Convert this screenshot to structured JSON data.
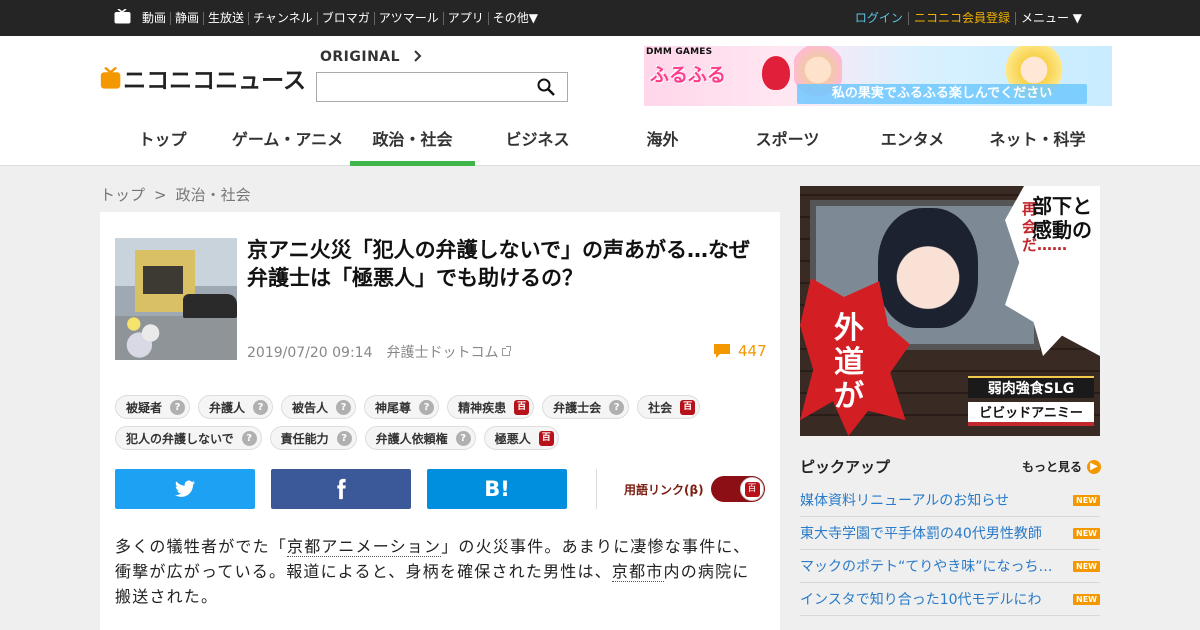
{
  "topbar": {
    "nav": [
      "動画",
      "静画",
      "生放送",
      "チャンネル",
      "ブロマガ",
      "アツマール",
      "アプリ",
      "その他▼"
    ],
    "login": "ログイン",
    "register": "ニコニコ会員登録",
    "menu": "メニュー ▼"
  },
  "header": {
    "logo_text": "ニコニコニュース",
    "original_label": "ORIGINAL",
    "search_value": "",
    "banner": {
      "brand": "DMM GAMES",
      "title": "ふるふる",
      "catch": "私の果実でふるふる楽しんでください"
    }
  },
  "categories": [
    "トップ",
    "ゲーム・アニメ",
    "政治・社会",
    "ビジネス",
    "海外",
    "スポーツ",
    "エンタメ",
    "ネット・科学"
  ],
  "active_category": 2,
  "breadcrumb": {
    "home": "トップ",
    "sep": ">",
    "current": "政治・社会"
  },
  "article": {
    "headline": "京アニ火災「犯人の弁護しないで」の声あがる…なぜ弁護士は「極悪人」でも助けるの？",
    "datetime": "2019/07/20 09:14",
    "source": "弁護士ドットコム",
    "comment_count": "447",
    "tags": [
      {
        "label": "被疑者",
        "kind": "q"
      },
      {
        "label": "弁護人",
        "kind": "q"
      },
      {
        "label": "被告人",
        "kind": "q"
      },
      {
        "label": "神尾尊",
        "kind": "q"
      },
      {
        "label": "精神疾患",
        "kind": "d"
      },
      {
        "label": "弁護士会",
        "kind": "q"
      },
      {
        "label": "社会",
        "kind": "d"
      },
      {
        "label": "犯人の弁護しないで",
        "kind": "q"
      },
      {
        "label": "責任能力",
        "kind": "q"
      },
      {
        "label": "弁護人依頼権",
        "kind": "q"
      },
      {
        "label": "極悪人",
        "kind": "d"
      }
    ],
    "tag_q_glyph": "?",
    "tag_d_glyph": "百",
    "share_hatena": "B!",
    "yougo_label": "用語リンク(β)",
    "body_parts": {
      "p1": "多くの犠牲者がでた「",
      "link1": "京都アニメーション",
      "p2": "」の火災事件。あまりに凄惨な事件に、衝撃が広がっている。報道によると、身柄を確保された男性は、",
      "link2": "京都市",
      "p3": "内の病院に搬送された。"
    }
  },
  "ad": {
    "burst_text": "外道が",
    "bubble_text": "部下と感動の",
    "side_text": "再会だ……",
    "genre": "弱肉強食SLG",
    "brand": "ビビッドアニミー"
  },
  "pickup": {
    "heading": "ピックアップ",
    "more": "もっと見る",
    "new_label": "NEW",
    "items": [
      "媒体資料リニューアルのお知らせ",
      "東大寺学園で平手体罰の40代男性教師",
      "マックのポテト“てりやき味”になっちゃう",
      "インスタで知り合った10代モデルにわ"
    ]
  },
  "colors": {
    "active_tab": "#3eb64a",
    "comment": "#f39800",
    "link": "#2a7bc8",
    "twitter": "#1da1f2",
    "facebook": "#3b5998",
    "hatena": "#008fde"
  }
}
